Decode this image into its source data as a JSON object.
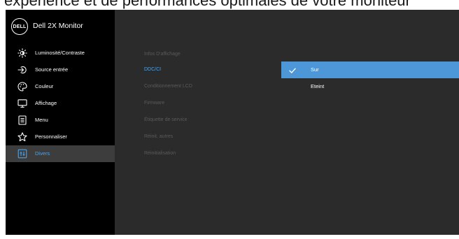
{
  "caption": "expérience et de performances optimales de votre moniteur",
  "app": {
    "logo_text": "DELL",
    "title": "Dell 2X Monitor"
  },
  "sidebar": {
    "items": [
      {
        "label": "Luminosité/Contraste",
        "icon": "brightness-icon",
        "active": false
      },
      {
        "label": "Source entrée",
        "icon": "input-source-icon",
        "active": false
      },
      {
        "label": "Couleur",
        "icon": "color-palette-icon",
        "active": false
      },
      {
        "label": "Affichage",
        "icon": "display-icon",
        "active": false
      },
      {
        "label": "Menu",
        "icon": "menu-icon",
        "active": false
      },
      {
        "label": "Personnaliser",
        "icon": "star-icon",
        "active": false
      },
      {
        "label": "Divers",
        "icon": "others-icon",
        "active": true
      }
    ]
  },
  "submenu": {
    "items": [
      {
        "label": "Infos D'affichage",
        "selected": false
      },
      {
        "label": "DDC/CI",
        "selected": true
      },
      {
        "label": "Conditionnement LCD",
        "selected": false
      },
      {
        "label": "Firmware",
        "selected": false
      },
      {
        "label": "Étiquette de service",
        "selected": false
      },
      {
        "label": "Réinit. autres",
        "selected": false
      },
      {
        "label": "Réinitialisation",
        "selected": false
      }
    ]
  },
  "options": {
    "items": [
      {
        "label": "Sur",
        "selected": true
      },
      {
        "label": "Eteint",
        "selected": false
      }
    ]
  },
  "colors": {
    "accent": "#4d97d9",
    "active_text": "#4ea3e8",
    "sidebar_bg": "#000000",
    "panel_bg": "#2b2b2b"
  }
}
